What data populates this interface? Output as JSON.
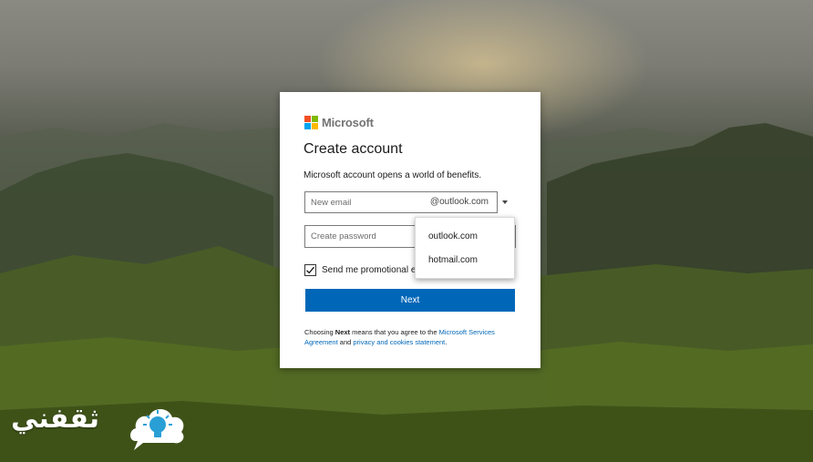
{
  "brand": {
    "name": "Microsoft",
    "logo_colors": [
      "#f25022",
      "#7fba00",
      "#00a4ef",
      "#ffb900"
    ]
  },
  "form": {
    "title": "Create account",
    "subtitle": "Microsoft account opens a world of benefits.",
    "email": {
      "placeholder": "New email",
      "value": "",
      "domain": "@outlook.com"
    },
    "password": {
      "placeholder": "Create password",
      "value": ""
    },
    "promo_checkbox": {
      "label": "Send me promotional e",
      "checked": true
    },
    "next_label": "Next",
    "legal": {
      "text_1": "Choosing ",
      "bold": "Next",
      "text_2": " means that you agree to the ",
      "link_agreement": "Microsoft Services Agreement",
      "text_3": " and ",
      "link_privacy": "privacy and cookies statement",
      "text_4": "."
    }
  },
  "domain_dropdown": {
    "options": [
      "outlook.com",
      "hotmail.com"
    ]
  },
  "watermark": {
    "text": "ثقفني",
    "icon": "lightbulb-cloud-icon"
  },
  "colors": {
    "primary_button": "#0067b8",
    "link": "#0067b8"
  }
}
